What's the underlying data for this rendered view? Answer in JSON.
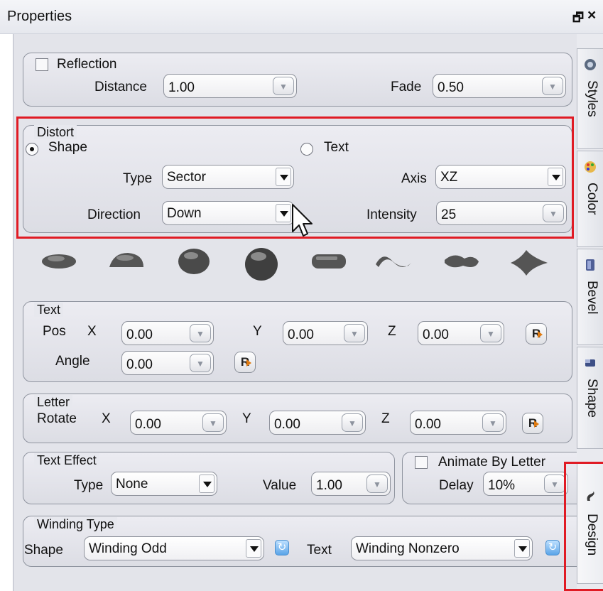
{
  "window": {
    "title": "Properties"
  },
  "reflection": {
    "label": "Reflection",
    "distance_label": "Distance",
    "distance_value": "1.00",
    "fade_label": "Fade",
    "fade_value": "0.50"
  },
  "distort": {
    "legend": "Distort",
    "shape_label": "Shape",
    "text_label": "Text",
    "type_label": "Type",
    "type_value": "Sector",
    "axis_label": "Axis",
    "axis_value": "XZ",
    "direction_label": "Direction",
    "direction_value": "Down",
    "intensity_label": "Intensity",
    "intensity_value": "25"
  },
  "text_group": {
    "legend": "Text",
    "pos_label": "Pos",
    "x_label": "X",
    "y_label": "Y",
    "z_label": "Z",
    "x_value": "0.00",
    "y_value": "0.00",
    "z_value": "0.00",
    "angle_label": "Angle",
    "angle_value": "0.00"
  },
  "letter": {
    "legend": "Letter",
    "rotate_label": "Rotate",
    "x_label": "X",
    "y_label": "Y",
    "z_label": "Z",
    "x_value": "0.00",
    "y_value": "0.00",
    "z_value": "0.00"
  },
  "text_effect": {
    "legend": "Text Effect",
    "type_label": "Type",
    "type_value": "None",
    "value_label": "Value",
    "value_value": "1.00"
  },
  "animate": {
    "label": "Animate By Letter",
    "delay_label": "Delay",
    "delay_value": "10%"
  },
  "winding": {
    "legend": "Winding Type",
    "shape_label": "Shape",
    "shape_value": "Winding Odd",
    "text_label": "Text",
    "text_value": "Winding Nonzero"
  },
  "side_tabs": [
    "Styles",
    "Color",
    "Bevel",
    "Shape",
    "Design"
  ],
  "colors": {
    "highlight": "#e01b24",
    "panel": "#e3e4ea"
  }
}
